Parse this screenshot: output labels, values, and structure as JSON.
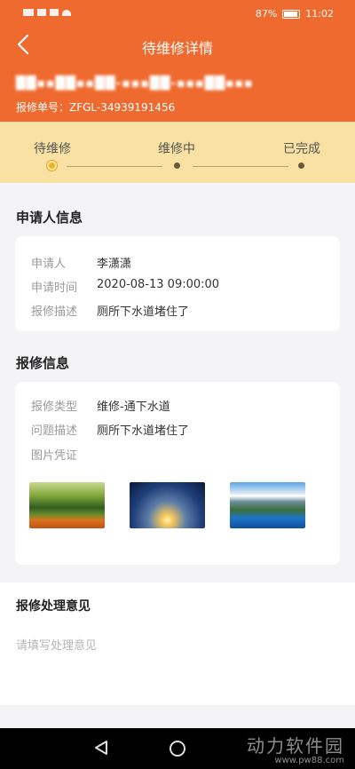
{
  "status_bar": {
    "battery": "87%",
    "time": "11:02"
  },
  "header": {
    "title": "待维修详情",
    "address": "██▪▪██▪▪██-▪▪▪██-▪▪▪██▪▪▪",
    "order_no": "报修单号：ZFGL-34939191456"
  },
  "progress": {
    "steps": [
      "待维修",
      "维修中",
      "已完成"
    ],
    "current_index": 0
  },
  "applicant": {
    "title": "申请人信息",
    "rows": [
      {
        "label": "申请人",
        "value": "李潇潇"
      },
      {
        "label": "申请时间",
        "value": "2020-08-13 09:00:00"
      },
      {
        "label": "报修描述",
        "value": "厕所下水道堵住了"
      }
    ]
  },
  "repair": {
    "title": "报修信息",
    "rows": [
      {
        "label": "报修类型",
        "value": "维修-通下水道"
      },
      {
        "label": "问题描述",
        "value": "厕所下水道堵住了"
      },
      {
        "label": "图片凭证",
        "value": ""
      }
    ],
    "photos": [
      "forest-photo",
      "sunset-photo",
      "mountain-lake-photo"
    ]
  },
  "opinion": {
    "title": "报修处理意见",
    "placeholder": "请填写处理意见"
  },
  "watermark": {
    "name": "动力软件园",
    "url": "www.pw88.com"
  },
  "colors": {
    "primary": "#ef6a2e",
    "progress_bg": "#f8e1a2",
    "page_bg": "#f4f4f6"
  }
}
